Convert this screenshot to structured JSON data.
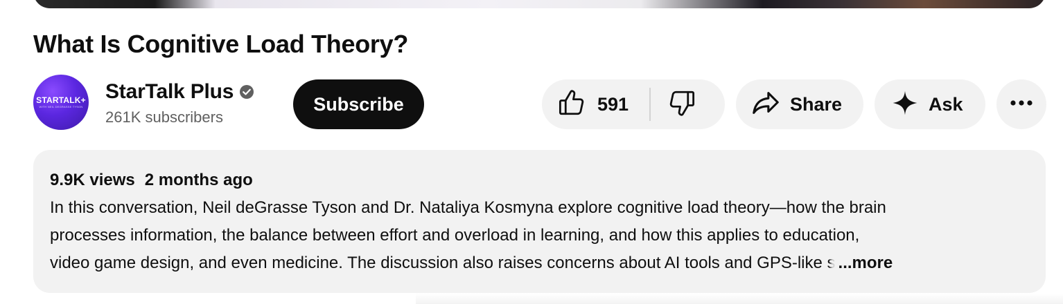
{
  "video": {
    "title": "What Is Cognitive Load Theory?"
  },
  "channel": {
    "name": "StarTalk Plus",
    "subscribers": "261K subscribers",
    "avatar_logo_text": "STARTALK+",
    "avatar_sub_text": "WITH NEIL DEGRASSE TYSON",
    "verified": true,
    "avatar_color": "#5b27e0"
  },
  "actions": {
    "subscribe_label": "Subscribe",
    "like_count": "591",
    "share_label": "Share",
    "ask_label": "Ask",
    "icons": [
      "thumbs-up-icon",
      "thumbs-down-icon",
      "share-arrow-icon",
      "sparkle-icon",
      "more-horizontal-icon"
    ]
  },
  "description": {
    "views": "9.9K views",
    "date": "2 months ago",
    "line1": "In this conversation, Neil deGrasse Tyson and Dr. Nataliya Kosmyna explore cognitive load theory—how the brain",
    "line2": "processes information, the balance between effort and overload in learning, and how this applies to education,",
    "line3": "video game design, and even medicine. The discussion also raises concerns about AI tools and GPS-like",
    "line3_fade": "s",
    "more_label": "...more"
  },
  "colors": {
    "text_primary": "#0f0f0f",
    "text_secondary": "#606060",
    "pill_bg": "#f2f2f2",
    "subscribe_bg": "#0f0f0f"
  }
}
